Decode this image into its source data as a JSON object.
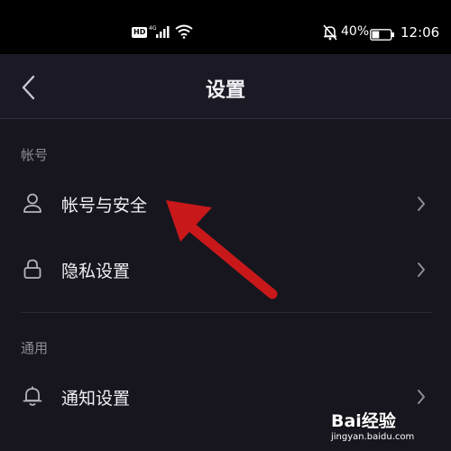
{
  "status_bar": {
    "hd_badge": "HD",
    "network_type": "4G",
    "battery_percent": "40%",
    "battery_level": 0.4,
    "time": "12:06",
    "icons": [
      "signal-icon",
      "wifi-icon",
      "notifications-muted-icon",
      "battery-icon"
    ]
  },
  "header": {
    "title": "设置",
    "back_icon": "chevron-left-icon"
  },
  "sections": [
    {
      "title": "帐号",
      "items": [
        {
          "label": "帐号与安全",
          "icon": "user-icon"
        },
        {
          "label": "隐私设置",
          "icon": "lock-icon"
        }
      ]
    },
    {
      "title": "通用",
      "items": [
        {
          "label": "通知设置",
          "icon": "bell-icon"
        }
      ]
    }
  ],
  "annotation": {
    "icon": "red-arrow-annotation",
    "color": "#c8181a"
  },
  "watermark": {
    "brand": "Bai经验",
    "url": "jingyan.baidu.com"
  },
  "colors": {
    "background": "#17161f",
    "status_bar": "#000000",
    "text_primary": "#f0f0f4",
    "text_secondary": "#8c8b96"
  }
}
